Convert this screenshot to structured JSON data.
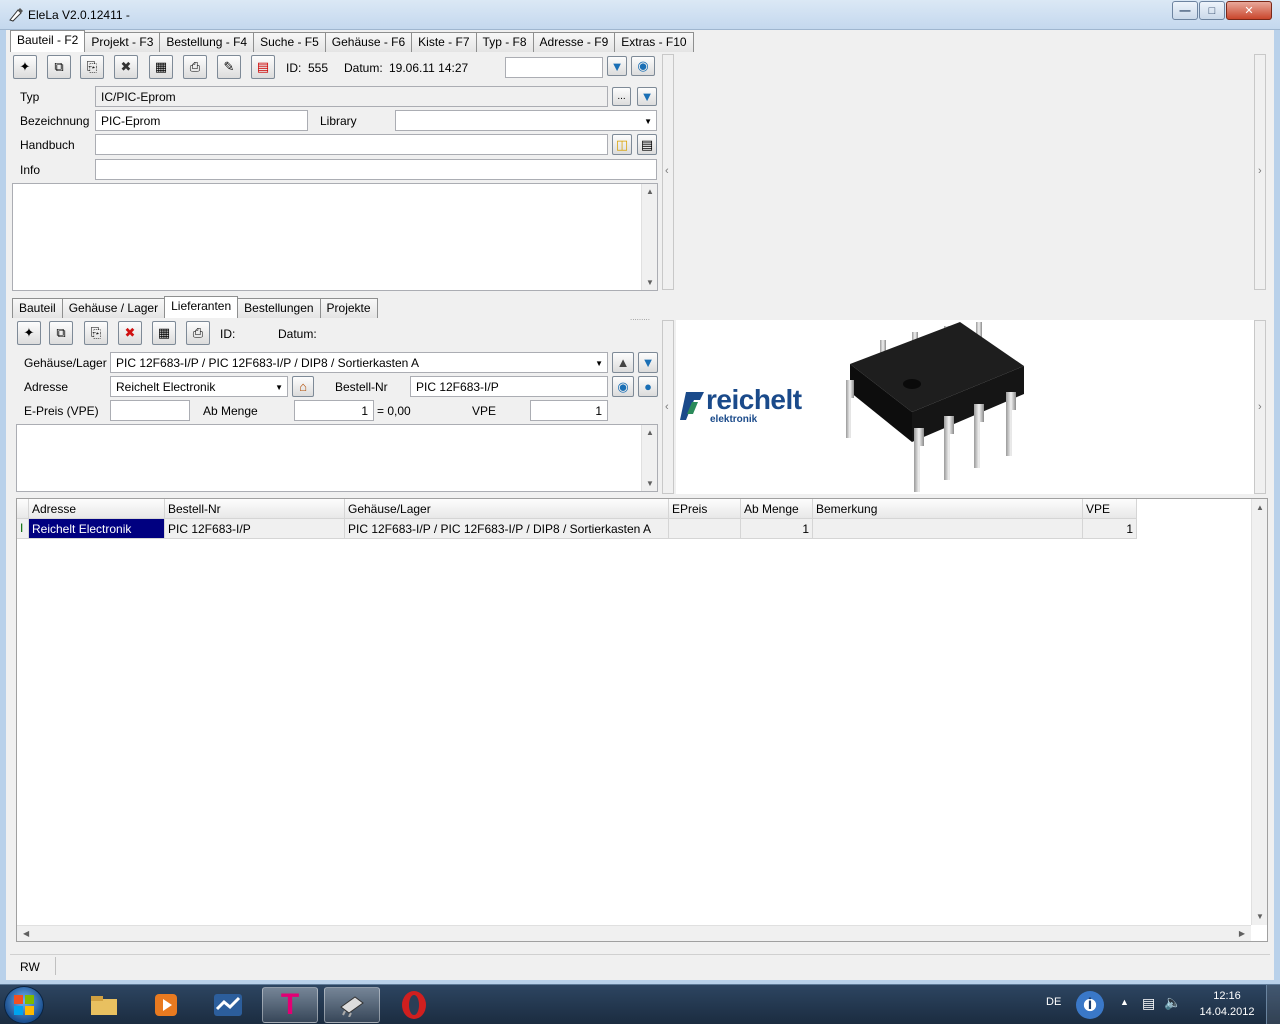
{
  "window": {
    "title": "EleLa V2.0.12411  -"
  },
  "main_tabs": [
    "Bauteil - F2",
    "Projekt - F3",
    "Bestellung - F4",
    "Suche - F5",
    "Gehäuse - F6",
    "Kiste - F7",
    "Typ - F8",
    "Adresse - F9",
    "Extras - F10"
  ],
  "bauteil": {
    "id_label": "ID:",
    "id_value": "555",
    "datum_label": "Datum:",
    "datum_value": "19.06.11 14:27",
    "typ_label": "Typ",
    "typ_value": "IC/PIC-Eprom",
    "bezeichnung_label": "Bezeichnung",
    "bezeichnung_value": "PIC-Eprom",
    "library_label": "Library",
    "library_value": "",
    "handbuch_label": "Handbuch",
    "handbuch_value": "",
    "info_label": "Info",
    "info_value": ""
  },
  "sub_tabs": [
    "Bauteil",
    "Gehäuse / Lager",
    "Lieferanten",
    "Bestellungen",
    "Projekte"
  ],
  "lieferant": {
    "id_label": "ID:",
    "datum_label": "Datum:",
    "gehaeuse_label": "Gehäuse/Lager",
    "gehaeuse_value": "PIC 12F683-I/P / PIC 12F683-I/P / DIP8 / Sortierkasten A",
    "adresse_label": "Adresse",
    "adresse_value": "Reichelt Electronik",
    "bestellnr_label": "Bestell-Nr",
    "bestellnr_value": "PIC 12F683-I/P",
    "epreis_label": "E-Preis (VPE)",
    "epreis_value": "",
    "abmenge_label": "Ab Menge",
    "abmenge_value": "1",
    "sum_text": "= 0,00",
    "vpe_label": "VPE",
    "vpe_value": "1"
  },
  "logo": {
    "text": "reichelt",
    "subtext": "elektronik"
  },
  "grid": {
    "columns": [
      "Adresse",
      "Bestell-Nr",
      "Gehäuse/Lager",
      "EPreis",
      "Ab Menge",
      "Bemerkung",
      "VPE"
    ],
    "rows": [
      [
        "Reichelt Electronik",
        "PIC 12F683-I/P",
        "PIC 12F683-I/P / PIC 12F683-I/P / DIP8 / Sortierkasten A",
        "",
        "1",
        "",
        "1"
      ]
    ]
  },
  "statusbar": {
    "mode": "RW"
  },
  "taskbar": {
    "lang": "DE",
    "time": "12:16",
    "date": "14.04.2012"
  },
  "colors": {
    "selection": "#000080",
    "reichelt_blue": "#1a4a8a"
  }
}
